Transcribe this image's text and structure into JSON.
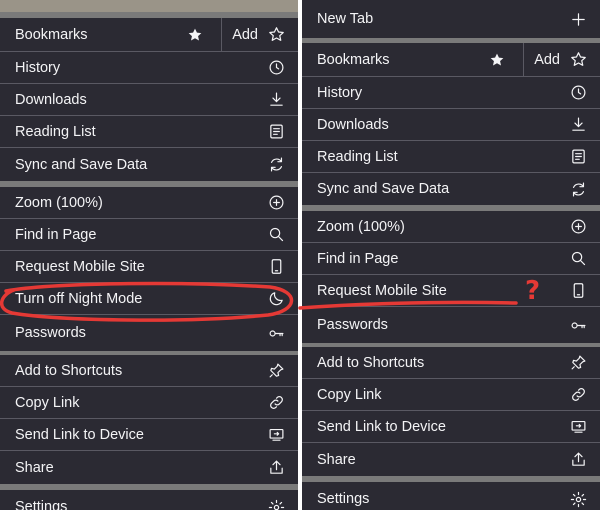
{
  "left_menu": {
    "bookmarks": "Bookmarks",
    "add": "Add",
    "history": "History",
    "downloads": "Downloads",
    "reading_list": "Reading List",
    "sync": "Sync and Save Data",
    "zoom": "Zoom (100%)",
    "find": "Find in Page",
    "request_mobile": "Request Mobile Site",
    "night_mode": "Turn off Night Mode",
    "passwords": "Passwords",
    "shortcuts": "Add to Shortcuts",
    "copy_link": "Copy Link",
    "send_link": "Send Link to Device",
    "share": "Share",
    "settings": "Settings"
  },
  "right_menu": {
    "new_tab": "New Tab",
    "bookmarks": "Bookmarks",
    "add": "Add",
    "history": "History",
    "downloads": "Downloads",
    "reading_list": "Reading List",
    "sync": "Sync and Save Data",
    "zoom": "Zoom (100%)",
    "find": "Find in Page",
    "request_mobile": "Request Mobile Site",
    "passwords": "Passwords",
    "shortcuts": "Add to Shortcuts",
    "copy_link": "Copy Link",
    "send_link": "Send Link to Device",
    "share": "Share",
    "settings": "Settings"
  },
  "annotation": {
    "mark": "?",
    "color": "#e53935"
  },
  "colors": {
    "menu_bg": "#2b2a33",
    "menu_text": "#f4f4f6",
    "separator": "#7a7a7a"
  }
}
